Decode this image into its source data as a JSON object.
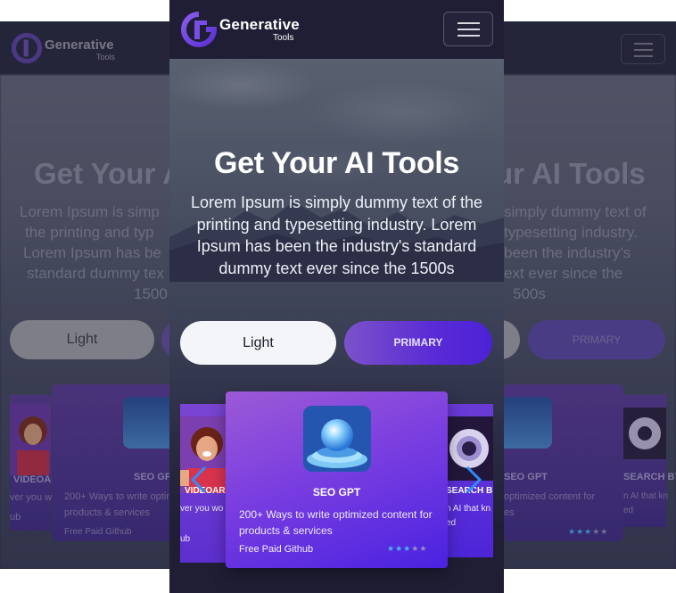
{
  "brand": {
    "name": "Generative",
    "sub": "Tools"
  },
  "hero": {
    "title": "Get Your AI Tools",
    "text": "Lorem Ipsum is simply dummy text of the printing and typesetting industry. Lorem Ipsum has been the industry's standard dummy text ever since the 1500s",
    "light_label": "Light",
    "primary_label": "PRIMARY"
  },
  "background": {
    "title_left": "Get Your A",
    "title_right": "ur AI Tools",
    "text_left": [
      "Lorem Ipsum is simp",
      "the printing and typ",
      "Lorem Ipsum has be",
      "standard dummy tex",
      "1500"
    ],
    "text_right": [
      "simply dummy text of",
      "typesetting industry.",
      "been the industry's",
      "ext ever since the",
      "500s"
    ],
    "light_label": "Light",
    "primary_label": "PRIMARY",
    "card_title": "SEO GPT",
    "card_desc_1": "200+ Ways to write optimi",
    "card_desc_2": "products & services",
    "card_tags": "Free Paid Github",
    "left_side_title": "VIDEOARI",
    "left_side_desc": "ver you wo",
    "left_side_tag": "ub",
    "right_card_title": "SEO GPT",
    "right_card_desc_1": "optimized content for",
    "right_card_desc_2": "es",
    "right_side_title": "SEARCH BY",
    "right_side_desc_1": "n AI that kn",
    "right_side_desc_2": "ed"
  },
  "carousel": {
    "main_card": {
      "title": "SEO GPT",
      "description": "200+ Ways to write optimized content for products & services",
      "tags": "Free Paid Github",
      "rating": 3,
      "rating_max": 5
    },
    "left_card": {
      "title": "VIDEOARI",
      "desc": "ver you wo",
      "tag": "ub"
    },
    "right_card": {
      "title": "SEARCH BY",
      "desc_1": "n AI that kn",
      "desc_2": "ed"
    }
  },
  "icons": {
    "menu": "hamburger-icon",
    "prev": "chevron-left-icon",
    "next": "chevron-right-icon"
  },
  "colors": {
    "nav_bg": "#1f1e35",
    "primary_start": "#7c52c9",
    "primary_end": "#4b22d6",
    "star_on": "#49b8ff"
  }
}
